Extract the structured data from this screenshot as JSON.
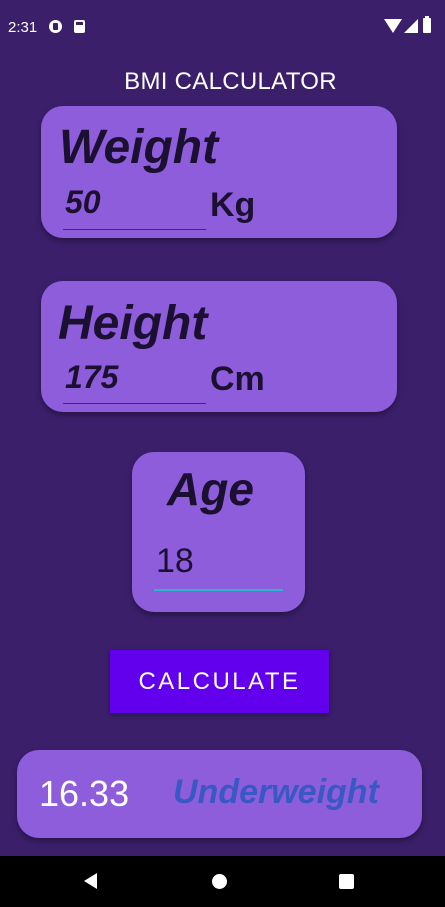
{
  "status_bar": {
    "time": "2:31"
  },
  "app": {
    "title": "BMI CALCULATOR"
  },
  "weight_card": {
    "label": "Weight",
    "value": "50",
    "unit": "Kg"
  },
  "height_card": {
    "label": "Height",
    "value": "175",
    "unit": "Cm"
  },
  "age_card": {
    "label": "Age",
    "value": "18"
  },
  "calculate_button": {
    "label": "CALCULATE"
  },
  "result": {
    "bmi": "16.33",
    "category": "Underweight"
  },
  "colors": {
    "background": "#3b1f6b",
    "card": "#8d5ddc",
    "button": "#6200ee",
    "category_text": "#3a58c4",
    "age_underline": "#2bb5c9"
  },
  "icons": [
    "status-app-icon",
    "sd-card-icon",
    "wifi-icon",
    "signal-icon",
    "battery-icon",
    "back-icon",
    "home-icon",
    "recents-icon"
  ]
}
